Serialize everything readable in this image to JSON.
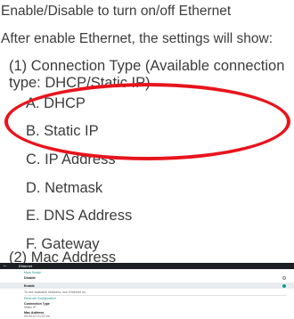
{
  "intro": {
    "line1": "Enable/Disable to turn on/off Ethernet",
    "line2": "After enable Ethernet, the settings will show:"
  },
  "connection": {
    "heading": "(1) Connection Type (Available connection type: DHCP/Static IP)",
    "options": [
      "A. DHCP",
      "B. Static IP",
      "C. IP Address",
      "D. Netmask",
      "E. DNS Address",
      "F. Gateway"
    ]
  },
  "mac_heading": "(2) Mac Address",
  "highlight_color": "#e8141c",
  "screenshot": {
    "title": "Ethernet",
    "back_icon": "arrow-left-icon",
    "main_switch": "Main Switch",
    "disable_label": "Disable",
    "enable_label": "Enable",
    "selected": "Enable",
    "hint": "To see available networks, turn Ethernet on.",
    "config_heading": "Ethernet Configuration",
    "connection_type_label": "Connection Type",
    "connection_type_value": "Static IP",
    "mac_label": "Mac Address",
    "mac_value": "00:04:07:21:57:ee",
    "accent": "#1f9a8f"
  }
}
